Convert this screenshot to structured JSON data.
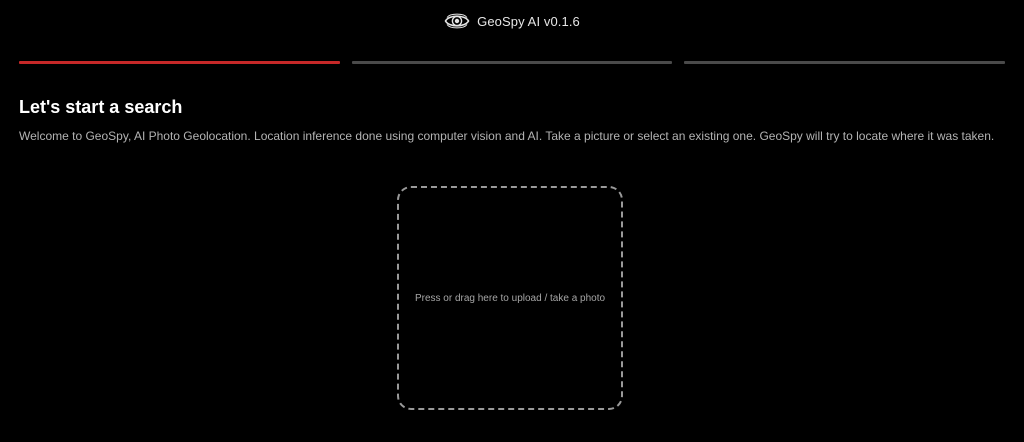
{
  "header": {
    "logo": "eye-logo-icon",
    "title": "GeoSpy AI v0.1.6"
  },
  "progress": {
    "steps": [
      {
        "state": "active",
        "color": "#c62828"
      },
      {
        "state": "inactive",
        "color": "#4a4a4a"
      },
      {
        "state": "inactive",
        "color": "#4a4a4a"
      }
    ],
    "current_step": 1,
    "total_steps": 3
  },
  "main": {
    "heading": "Let's start a search",
    "description": "Welcome to GeoSpy, AI Photo Geolocation. Location inference done using computer vision and AI. Take a picture or select an existing one. GeoSpy will try to locate where it was taken.",
    "upload_prompt": "Press or drag here to upload / take a photo"
  },
  "colors": {
    "background": "#000000",
    "accent": "#c62828",
    "inactive": "#4a4a4a",
    "text_primary": "#ffffff",
    "text_secondary": "#b3b3b3"
  }
}
